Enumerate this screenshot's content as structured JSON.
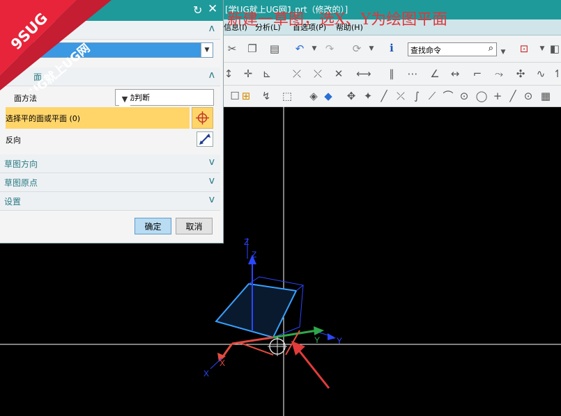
{
  "window": {
    "title": "[学UG就上UG网1.prt（修改的）]"
  },
  "overlay": {
    "headline": "新建一草图，选X、Y为绘图平面",
    "ribbon_badge": "9SUG",
    "ribbon_text": "学UG就上UG网"
  },
  "menu": {
    "items": [
      "信息(I)",
      "分析(L)",
      "首选项(P)",
      "帮助(H)"
    ]
  },
  "toolbar": {
    "search_placeholder": "查找命令"
  },
  "dialog": {
    "section_plane_label": "面",
    "plane_method_label": "面方法",
    "plane_method_value": "自动判断",
    "select_face_label": "选择平的面或平面 (0)",
    "reverse_label": "反向",
    "section_direction": "草图方向",
    "section_origin": "草图原点",
    "section_settings": "设置",
    "ok": "确定",
    "cancel": "取消"
  },
  "viewport": {
    "axis_z": "Z",
    "axis_y": "Y",
    "axis_x": "X",
    "colors": {
      "x": "#e24b3f",
      "y": "#2fa84a",
      "z": "#2b46ff",
      "plane": "#39a0ff",
      "arrow": "#e33b3b"
    }
  }
}
